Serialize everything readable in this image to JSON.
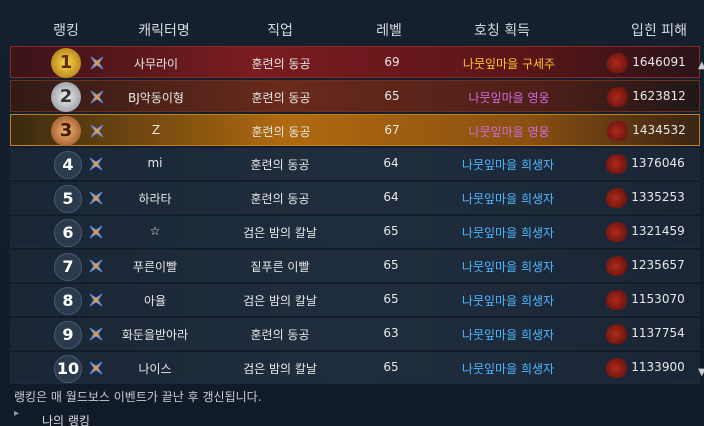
{
  "header": {
    "rank": "랭킹",
    "name": "캐릭터명",
    "job": "직업",
    "level": "레벨",
    "title": "호칭 획득",
    "damage": "입힌 피해"
  },
  "rows": [
    {
      "rank": "1",
      "name": "사무라이",
      "job": "훈련의 동공",
      "level": "69",
      "title": "나뭇잎마을 구세주",
      "damage": "1646091"
    },
    {
      "rank": "2",
      "name": "BJ악동이형",
      "job": "훈련의 동공",
      "level": "65",
      "title": "나뭇잎마을 영웅",
      "damage": "1623812"
    },
    {
      "rank": "3",
      "name": "Z",
      "job": "훈련의 동공",
      "level": "67",
      "title": "나뭇잎마을 영웅",
      "damage": "1434532"
    },
    {
      "rank": "4",
      "name": "mi",
      "job": "훈련의 동공",
      "level": "64",
      "title": "나뭇잎마을 희생자",
      "damage": "1376046"
    },
    {
      "rank": "5",
      "name": "하라타",
      "job": "훈련의 동공",
      "level": "64",
      "title": "나뭇잎마을 희생자",
      "damage": "1335253"
    },
    {
      "rank": "6",
      "name": "☆",
      "job": "검은 밤의 칼날",
      "level": "65",
      "title": "나뭇잎마을 희생자",
      "damage": "1321459"
    },
    {
      "rank": "7",
      "name": "푸른이빨",
      "job": "짙푸른 이빨",
      "level": "65",
      "title": "나뭇잎마을 희생자",
      "damage": "1235657"
    },
    {
      "rank": "8",
      "name": "아율",
      "job": "검은 밤의 칼날",
      "level": "65",
      "title": "나뭇잎마을 희생자",
      "damage": "1153070"
    },
    {
      "rank": "9",
      "name": "화둔을받아라",
      "job": "훈련의 동공",
      "level": "63",
      "title": "나뭇잎마을 희생자",
      "damage": "1137754"
    },
    {
      "rank": "10",
      "name": "나이스",
      "job": "검은 밤의 칼날",
      "level": "65",
      "title": "나뭇잎마을 희생자",
      "damage": "1133900"
    }
  ],
  "footer_note": "랭킹은 매 월드보스 이벤트가 끝난 후 갱신됩니다.",
  "my_rank_label": "나의 랭킹",
  "colors": {
    "gold": "#ffc42a",
    "purple": "#d16be0",
    "blue": "#4fb8ff"
  }
}
